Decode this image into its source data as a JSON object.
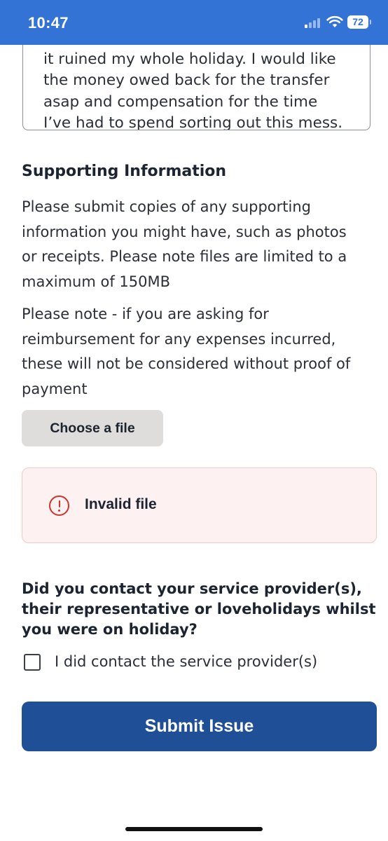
{
  "status_bar": {
    "time": "10:47",
    "battery": "72",
    "signal_icon": "cellular-signal-icon",
    "wifi_icon": "wifi-icon",
    "background_color": "#3473d6"
  },
  "description_textarea": {
    "visible_lines": [
      "it ruined my whole holiday. I would like",
      "the money owed back for the transfer",
      "asap and compensation for the time",
      "I’ve had to spend sorting out this mess."
    ]
  },
  "supporting_information": {
    "heading": "Supporting Information",
    "paragraph1_lines": [
      "Please submit copies of any supporting",
      "information you might have, such as photos",
      "or receipts. Please note files are limited to a",
      "maximum of 150MB"
    ],
    "paragraph2_lines": [
      "Please note - if you are asking for",
      "reimbursement for any expenses incurred,",
      "these will not be considered without proof of",
      "payment"
    ],
    "choose_file_label": "Choose a file"
  },
  "error": {
    "icon": "exclamation-circle-icon",
    "message": "Invalid file",
    "color": "#d0342c"
  },
  "contact_question": {
    "lines": [
      "Did you contact your service provider(s),",
      "their representative or loveholidays whilst",
      "you were on holiday?"
    ],
    "checkbox_label": "I did contact the service provider(s)",
    "checked": false
  },
  "submit_label": "Submit Issue",
  "accent_color": "#1f4f97"
}
